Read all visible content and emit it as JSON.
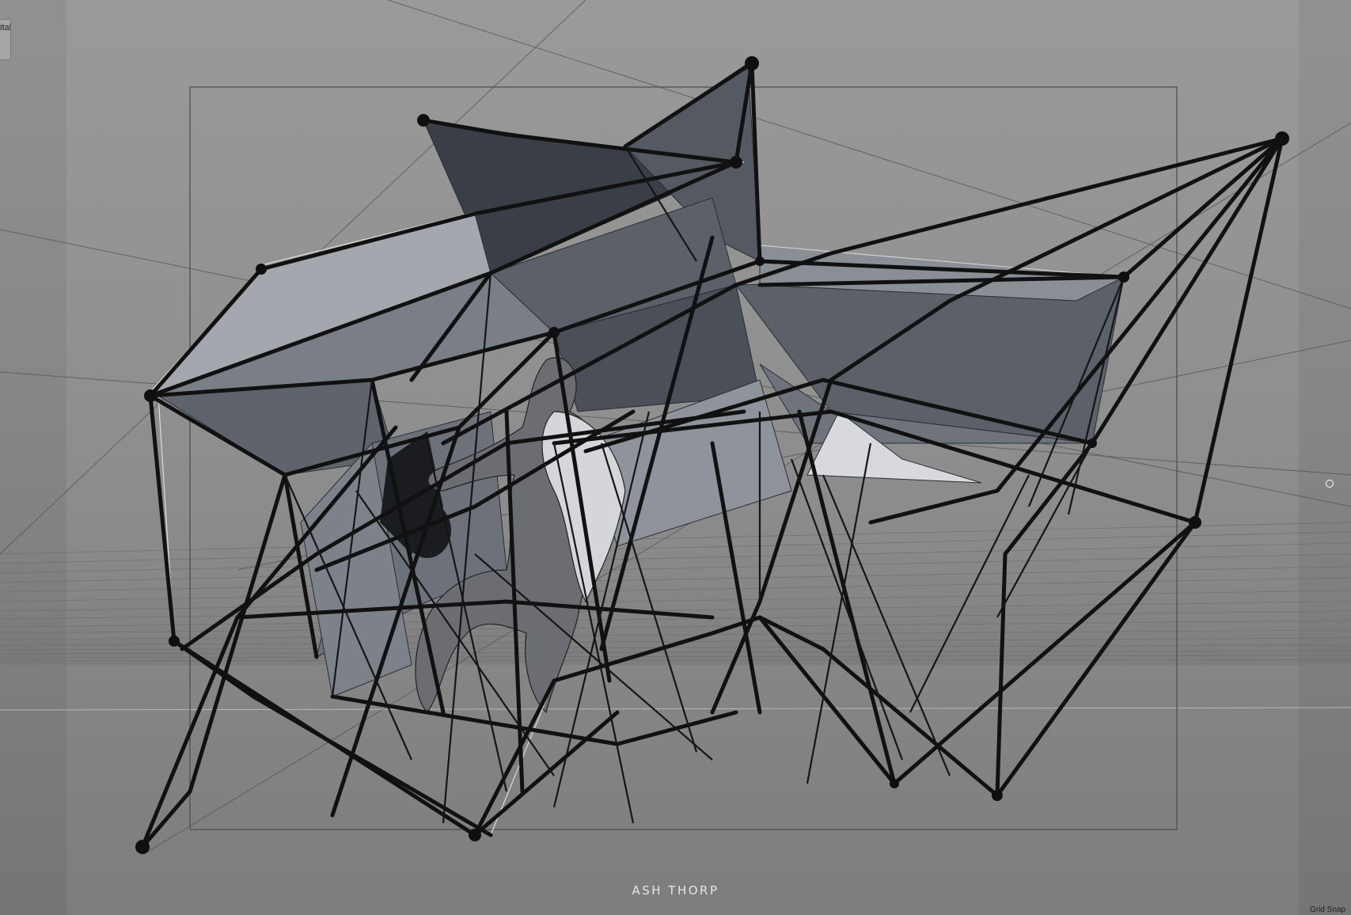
{
  "viewport": {
    "corner_tab_label": "ital",
    "watermark": "ASH THORP",
    "grid_snap_label": "Grid Snap"
  },
  "icons": {
    "nav_ring": "navigation-circle-icon"
  },
  "colors": {
    "background": "#8d8d8d",
    "panel_dark": "#3d414a",
    "panel_mid": "#5b6069",
    "panel_light": "#a3a6ad",
    "wire": "#111111",
    "wire_highlight": "#e8e8e8",
    "grid_line": "#6a6a6a",
    "safe_frame": "#4a4a4a"
  }
}
